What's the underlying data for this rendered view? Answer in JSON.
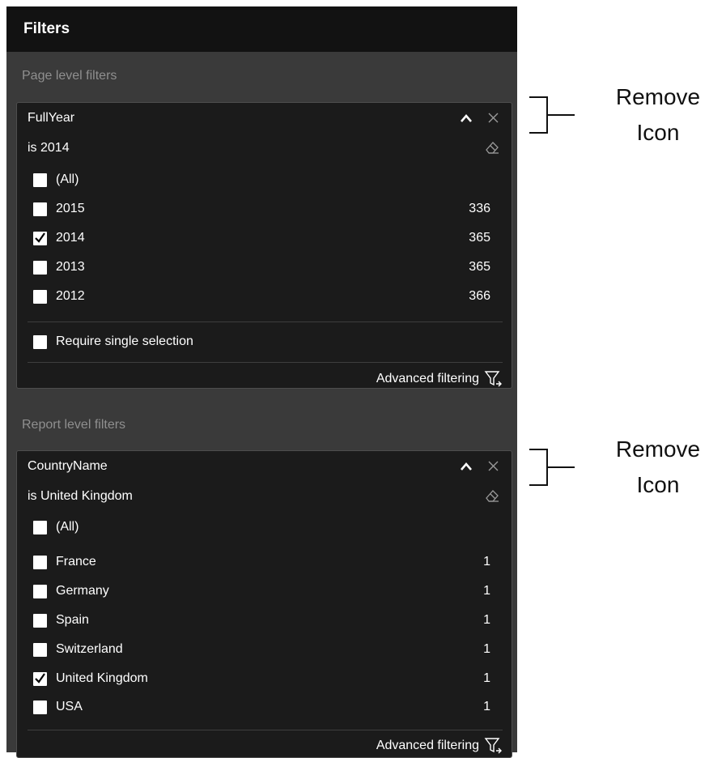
{
  "panel": {
    "title": "Filters"
  },
  "page_filters": {
    "section_label": "Page level filters",
    "card": {
      "field": "FullYear",
      "condition": "is 2014",
      "options": [
        {
          "label": "(All)",
          "count": "",
          "checked": false
        },
        {
          "label": "2015",
          "count": "336",
          "checked": false
        },
        {
          "label": "2014",
          "count": "365",
          "checked": true
        },
        {
          "label": "2013",
          "count": "365",
          "checked": false
        },
        {
          "label": "2012",
          "count": "366",
          "checked": false
        }
      ],
      "require_single": "Require single selection",
      "advanced": "Advanced filtering"
    }
  },
  "report_filters": {
    "section_label": "Report level filters",
    "card": {
      "field": "CountryName",
      "condition": "is United Kingdom",
      "options": [
        {
          "label": "(All)",
          "count": "",
          "checked": false
        },
        {
          "label": "France",
          "count": "1",
          "checked": false
        },
        {
          "label": "Germany",
          "count": "1",
          "checked": false
        },
        {
          "label": "Spain",
          "count": "1",
          "checked": false
        },
        {
          "label": "Switzerland",
          "count": "1",
          "checked": false
        },
        {
          "label": "United Kingdom",
          "count": "1",
          "checked": true
        },
        {
          "label": "USA",
          "count": "1",
          "checked": false
        }
      ],
      "advanced": "Advanced filtering"
    }
  },
  "annotations": {
    "callout_1": {
      "line1": "Remove",
      "line2": "Icon"
    },
    "callout_2": {
      "line1": "Remove",
      "line2": "Icon"
    }
  },
  "icons": {
    "collapse": "chevron-up-icon",
    "remove": "close-icon",
    "clear": "eraser-icon",
    "advanced": "funnel-icon",
    "checked": "checkmark-icon"
  },
  "colors": {
    "header_bg": "#121212",
    "panel_bg": "#3a3a3a",
    "card_bg": "#1b1b1b",
    "section_label": "#8f8f8f"
  }
}
